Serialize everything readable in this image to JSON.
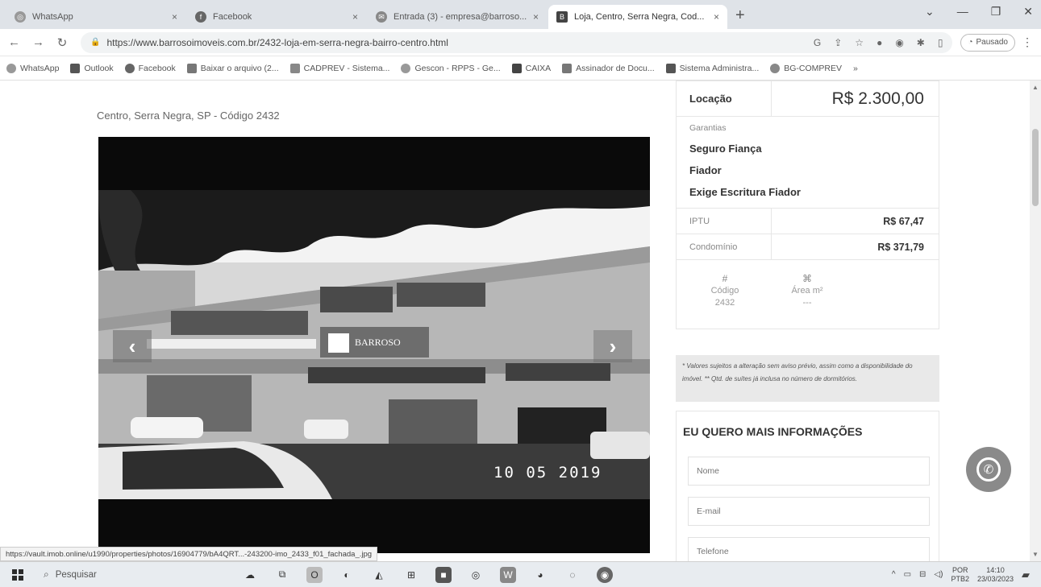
{
  "browser": {
    "tabs": [
      {
        "title": "WhatsApp",
        "active": false
      },
      {
        "title": "Facebook",
        "active": false
      },
      {
        "title": "Entrada (3) - empresa@barroso...",
        "active": false
      },
      {
        "title": "Loja, Centro, Serra Negra, Cod...",
        "active": true
      }
    ],
    "url": "https://www.barrosoimoveis.com.br/2432-loja-em-serra-negra-bairro-centro.html",
    "profile_label": "Pausado",
    "bookmarks": [
      "WhatsApp",
      "Outlook",
      "Facebook",
      "Baixar o arquivo (2...",
      "CADPREV - Sistema...",
      "Gescon - RPPS - Ge...",
      "CAIXA",
      "Assinador de Docu...",
      "Sistema Administra...",
      "BG-COMPREV"
    ]
  },
  "listing": {
    "location_line": "Centro, Serra Negra, SP - Código 2432",
    "photo_timestamp": "10 05 2019",
    "sign_text": "BARROSO",
    "prev_arrow": "‹",
    "next_arrow": "›"
  },
  "pricing": {
    "rent_label": "Locação",
    "rent_value": "R$ 2.300,00",
    "guarantees_title": "Garantias",
    "guarantees": [
      "Seguro Fiança",
      "Fiador",
      "Exige Escritura Fiador"
    ],
    "fees": [
      {
        "label": "IPTU",
        "value": "R$ 67,47"
      },
      {
        "label": "Condomínio",
        "value": "R$ 371,79"
      }
    ]
  },
  "features": [
    {
      "icon": "#",
      "label": "Código",
      "value": "2432"
    },
    {
      "icon": "⌘",
      "label": "Área m²",
      "value": "---"
    }
  ],
  "notice": "* Valores sujeitos a alteração sem aviso prévio, assim como a disponibilidade do imóvel. ** Qtd. de suítes já inclusa no número de dormitórios.",
  "contact_form": {
    "title": "EU QUERO MAIS INFORMAÇÕES",
    "name_placeholder": "Nome",
    "email_placeholder": "E-mail",
    "phone_placeholder": "Telefone"
  },
  "status_url": "https://vault.imob.online/u1990/properties/photos/16904779/bA4QRT...-243200-imo_2433_f01_fachada_.jpg",
  "taskbar": {
    "search_placeholder": "Pesquisar",
    "language": "POR",
    "layout": "PTB2",
    "time": "14:10",
    "date": "23/03/2023"
  }
}
